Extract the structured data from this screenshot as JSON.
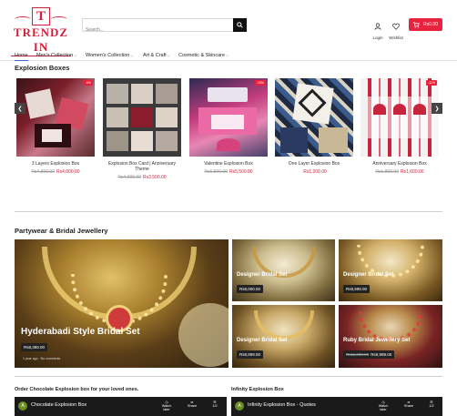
{
  "header": {
    "logo_letter": "T",
    "logo_text": "TRENDZ IN",
    "search_placeholder": "Search...",
    "login_label": "Login",
    "wishlist_label": "Wishlist",
    "cart_total": "Rs0.00",
    "accent_color": "#e8233e"
  },
  "nav": {
    "items": [
      {
        "label": "Home",
        "dropdown": false
      },
      {
        "label": "Men's Collection",
        "dropdown": true
      },
      {
        "label": "Women's Collection",
        "dropdown": true
      },
      {
        "label": "Art & Craft",
        "dropdown": true
      },
      {
        "label": "Cosmetic & Skincare",
        "dropdown": true
      }
    ]
  },
  "explosion": {
    "title": "Explosion Boxes",
    "products": [
      {
        "name": "3 Layers Explosion Box",
        "old_price": "Rs4,800.00",
        "price": "Rs4,000.00",
        "sale": "-9%"
      },
      {
        "name": "Explosion Box Card | Anniversary Theme",
        "old_price": "Rs4,000.00",
        "price": "Rs3,500.00",
        "sale": ""
      },
      {
        "name": "Valentine Explosion Box",
        "old_price": "Rs6,500.00",
        "price": "Rs5,500.00",
        "sale": "-15%"
      },
      {
        "name": "One Layer Explosion Box",
        "old_price": "",
        "price": "Rs1,200.00",
        "sale": ""
      },
      {
        "name": "Anniversary Explosion Box",
        "old_price": "Rs1,800.00",
        "price": "Rs1,600.00",
        "sale": "-11%"
      }
    ]
  },
  "jewellery": {
    "title": "Partywear & Bridal Jewellery",
    "featured": {
      "title": "Hyderabadi Style Bridal Set",
      "price": "Rs8,399.00",
      "meta": "1 year ago  ·  No comments"
    },
    "tiles": [
      {
        "title": "Designer Bridal Set",
        "price": "Rs8,000.00",
        "old_price": ""
      },
      {
        "title": "Designer Bridal Set",
        "price": "Rs8,999.00",
        "old_price": ""
      },
      {
        "title": "Designer Bridal Set",
        "price": "Rs8,999.00",
        "old_price": ""
      },
      {
        "title": "Ruby Bridal Jewellery Set",
        "price": "Rs9,999.00",
        "old_price": "Rs11,000.00"
      }
    ]
  },
  "videos": [
    {
      "section_title": "Order Chocolate Explosion box for your loved ones.",
      "title": "Chocolate Explosion Box",
      "channel_letter": "A",
      "watch_later": "Watch later",
      "share": "Share",
      "count": "1/2"
    },
    {
      "section_title": "Infinity Explosion Box",
      "title": "Infinity Explosion Box - Quotes",
      "channel_letter": "A",
      "watch_later": "Watch later",
      "share": "Share",
      "count": "1/2"
    }
  ]
}
